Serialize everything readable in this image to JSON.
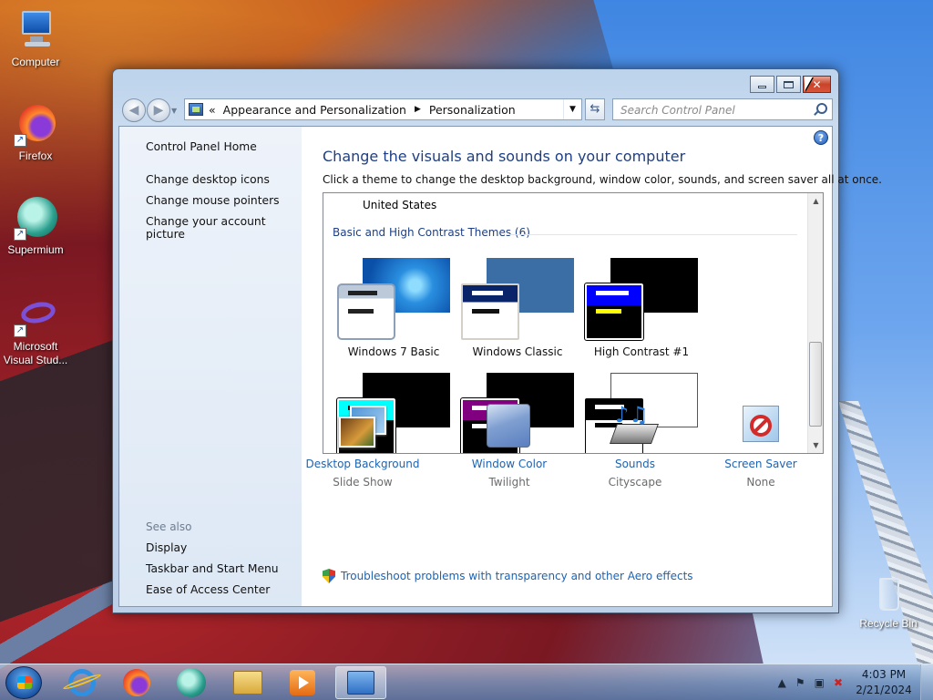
{
  "desktop": {
    "icons": [
      {
        "label": "Computer"
      },
      {
        "label": "Firefox"
      },
      {
        "label": "Supermium"
      },
      {
        "label": "Microsoft Visual Stud..."
      },
      {
        "label": "Recycle Bin"
      }
    ]
  },
  "window": {
    "breadcrumb": {
      "prefix": "«",
      "items": [
        "Appearance and Personalization",
        "Personalization"
      ]
    },
    "search_placeholder": "Search Control Panel",
    "left_pane": {
      "home": "Control Panel Home",
      "links": [
        "Change desktop icons",
        "Change mouse pointers",
        "Change your account picture"
      ],
      "see_also_heading": "See also",
      "see_also": [
        "Display",
        "Taskbar and Start Menu",
        "Ease of Access Center"
      ]
    },
    "main": {
      "title": "Change the visuals and sounds on your computer",
      "subtitle": "Click a theme to change the desktop background, window color, sounds, and screen saver all at once.",
      "country": "United States",
      "group_heading": "Basic and High Contrast Themes (6)",
      "themes": [
        {
          "label": "Windows 7 Basic"
        },
        {
          "label": "Windows Classic"
        },
        {
          "label": "High Contrast #1"
        },
        {
          "label": ""
        },
        {
          "label": ""
        },
        {
          "label": ""
        }
      ],
      "categories": [
        {
          "title": "Desktop Background",
          "value": "Slide Show"
        },
        {
          "title": "Window Color",
          "value": "Twilight"
        },
        {
          "title": "Sounds",
          "value": "Cityscape"
        },
        {
          "title": "Screen Saver",
          "value": "None"
        }
      ],
      "troubleshoot": "Troubleshoot problems with transparency and other Aero effects"
    }
  },
  "taskbar": {
    "time": "4:03 PM",
    "date": "2/21/2024"
  },
  "colors": {
    "link": "#1d63b2",
    "heading": "#1e3f84"
  }
}
